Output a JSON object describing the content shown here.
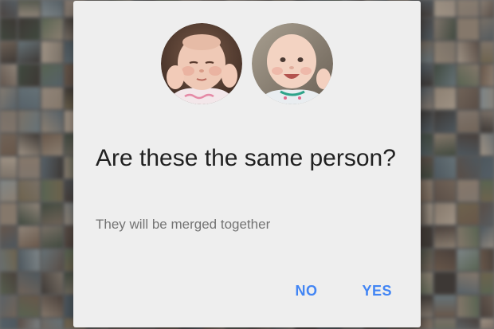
{
  "dialog": {
    "title": "Are these the same person?",
    "subtitle": "They will be merged together",
    "no_label": "NO",
    "yes_label": "YES",
    "faces": [
      {
        "icon": "baby-face-photo-sleepy"
      },
      {
        "icon": "baby-face-photo-smiling"
      }
    ]
  },
  "colors": {
    "dialog_background": "#eeeeee",
    "button_accent": "#4285f4",
    "title_text": "#212121",
    "subtitle_text": "#737373"
  }
}
